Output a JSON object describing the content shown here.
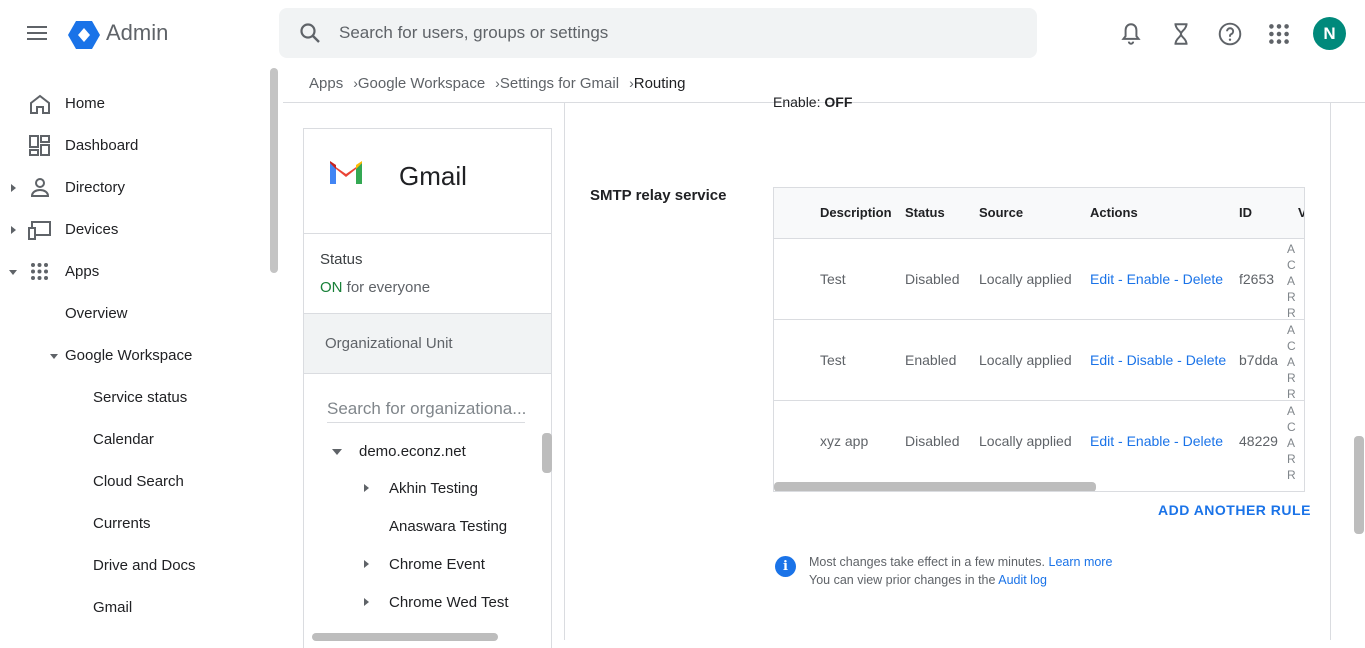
{
  "header": {
    "brand": "Admin",
    "search_placeholder": "Search for users, groups or settings",
    "avatar_initial": "N"
  },
  "sidebar": {
    "items": [
      {
        "label": "Home"
      },
      {
        "label": "Dashboard"
      },
      {
        "label": "Directory"
      },
      {
        "label": "Devices"
      },
      {
        "label": "Apps"
      },
      {
        "label": "Overview"
      },
      {
        "label": "Google Workspace"
      },
      {
        "label": "Service status"
      },
      {
        "label": "Calendar"
      },
      {
        "label": "Cloud Search"
      },
      {
        "label": "Currents"
      },
      {
        "label": "Drive and Docs"
      },
      {
        "label": "Gmail"
      }
    ]
  },
  "breadcrumb": {
    "items": [
      "Apps",
      "Google Workspace",
      "Settings for Gmail",
      "Routing"
    ]
  },
  "panel": {
    "title": "Gmail",
    "status_label": "Status",
    "status_on": "ON",
    "status_rest": " for everyone",
    "ou_header": "Organizational Unit",
    "ou_search_placeholder": "Search for organizationa...",
    "tree": [
      "demo.econz.net",
      "Akhin Testing",
      "Anaswara Testing",
      "Chrome Event",
      "Chrome Wed Test"
    ]
  },
  "main": {
    "enable_label": "Enable:",
    "enable_value": "OFF",
    "section_title": "SMTP relay service",
    "table": {
      "headers": [
        "Description",
        "Status",
        "Source",
        "Actions",
        "ID",
        "V"
      ],
      "rows": [
        {
          "description": "Test",
          "status": "Disabled",
          "source": "Locally applied",
          "actions": "Edit - Enable - Delete",
          "id": "f2653"
        },
        {
          "description": "Test",
          "status": "Enabled",
          "source": "Locally applied",
          "actions": "Edit - Disable - Delete",
          "id": "b7dda"
        },
        {
          "description": "xyz app",
          "status": "Disabled",
          "source": "Locally applied",
          "actions": "Edit - Enable - Delete",
          "id": "48229"
        }
      ],
      "clipped_column_letters": [
        "A",
        "C",
        "A",
        "R",
        "R"
      ]
    },
    "add_rule_label": "ADD ANOTHER RULE",
    "info": {
      "line1": "Most changes take effect in a few minutes.",
      "line1_link": "Learn more",
      "line2": "You can view prior changes in the",
      "line2_link": "Audit log"
    }
  },
  "colors": {
    "accent": "#1a73e8",
    "status_on": "#188038",
    "avatar": "#00897b"
  }
}
